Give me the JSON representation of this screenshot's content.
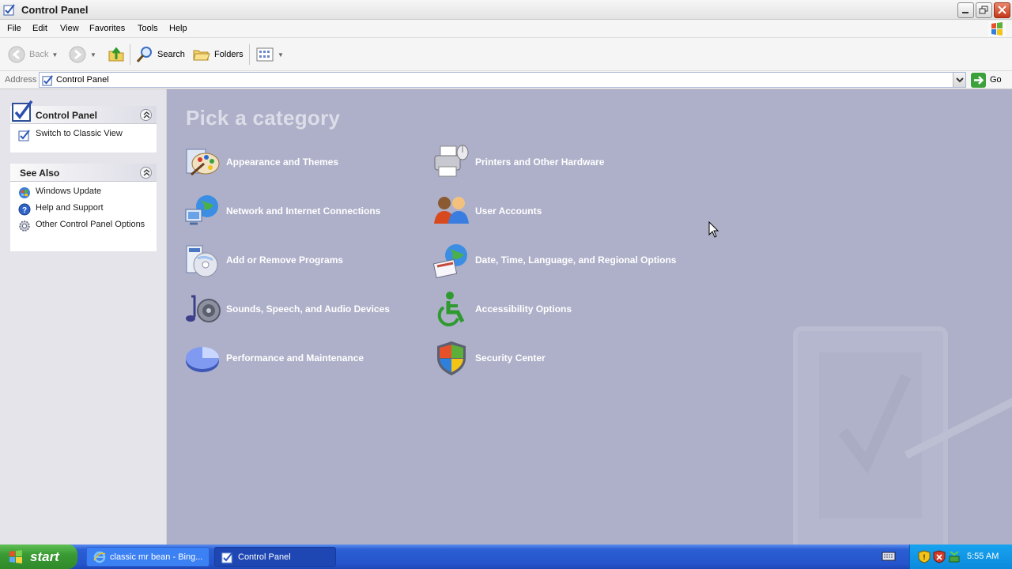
{
  "window": {
    "title": "Control Panel"
  },
  "menu": [
    "File",
    "Edit",
    "View",
    "Favorites",
    "Tools",
    "Help"
  ],
  "toolbar": {
    "back": "Back",
    "search": "Search",
    "folders": "Folders"
  },
  "address": {
    "label": "Address",
    "value": "Control Panel",
    "go": "Go"
  },
  "taskpane": {
    "control_panel": {
      "title": "Control Panel",
      "tasks": [
        "Switch to Classic View"
      ]
    },
    "see_also": {
      "title": "See Also",
      "links": [
        "Windows Update",
        "Help and Support",
        "Other Control Panel Options"
      ]
    }
  },
  "main": {
    "heading": "Pick a category",
    "categories_left": [
      {
        "label": "Appearance and Themes",
        "icon": "appearance-icon"
      },
      {
        "label": "Network and Internet Connections",
        "icon": "network-icon"
      },
      {
        "label": "Add or Remove Programs",
        "icon": "programs-icon"
      },
      {
        "label": "Sounds, Speech, and Audio Devices",
        "icon": "sounds-icon"
      },
      {
        "label": "Performance and Maintenance",
        "icon": "performance-icon"
      }
    ],
    "categories_right": [
      {
        "label": "Printers and Other Hardware",
        "icon": "printer-icon"
      },
      {
        "label": "User Accounts",
        "icon": "users-icon"
      },
      {
        "label": "Date, Time, Language, and Regional Options",
        "icon": "datetime-icon"
      },
      {
        "label": "Accessibility Options",
        "icon": "accessibility-icon"
      },
      {
        "label": "Security Center",
        "icon": "security-shield-icon"
      }
    ]
  },
  "taskbar": {
    "start": "start",
    "tasks": [
      "classic mr bean - Bing...",
      "Control Panel"
    ],
    "clock": "5:55 AM"
  },
  "colors": {
    "content_bg": "#aeb0c9",
    "taskbar": "#2554cc",
    "start": "#3a9a34"
  }
}
